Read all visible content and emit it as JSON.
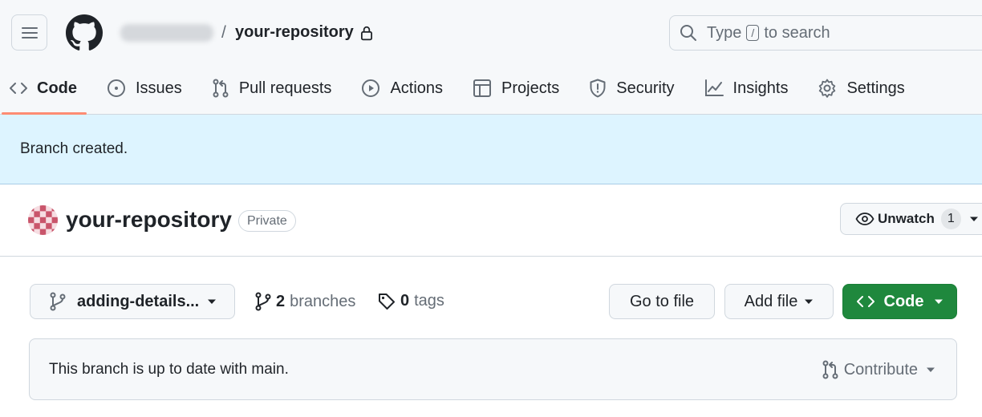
{
  "header": {
    "repo_name": "your-repository",
    "separator": "/",
    "search": {
      "prefix": "Type",
      "key": "/",
      "suffix": "to search"
    }
  },
  "nav": {
    "tabs": [
      {
        "label": "Code",
        "icon": "code-icon",
        "active": true
      },
      {
        "label": "Issues",
        "icon": "issue-icon"
      },
      {
        "label": "Pull requests",
        "icon": "pull-request-icon"
      },
      {
        "label": "Actions",
        "icon": "play-icon"
      },
      {
        "label": "Projects",
        "icon": "table-icon"
      },
      {
        "label": "Security",
        "icon": "shield-icon"
      },
      {
        "label": "Insights",
        "icon": "graph-icon"
      },
      {
        "label": "Settings",
        "icon": "gear-icon"
      }
    ]
  },
  "flash": {
    "message": "Branch created."
  },
  "repo": {
    "title": "your-repository",
    "visibility": "Private",
    "unwatch_label": "Unwatch",
    "watch_count": "1"
  },
  "toolbar": {
    "branch_name": "adding-details...",
    "branches_count": "2",
    "branches_label": "branches",
    "tags_count": "0",
    "tags_label": "tags",
    "go_to_file": "Go to file",
    "add_file": "Add file",
    "code": "Code"
  },
  "status": {
    "message": "This branch is up to date with main.",
    "contribute": "Contribute"
  },
  "colors": {
    "accent_green": "#1f883d",
    "active_tab_underline": "#fd8c73",
    "flash_background": "#ddf4ff"
  }
}
